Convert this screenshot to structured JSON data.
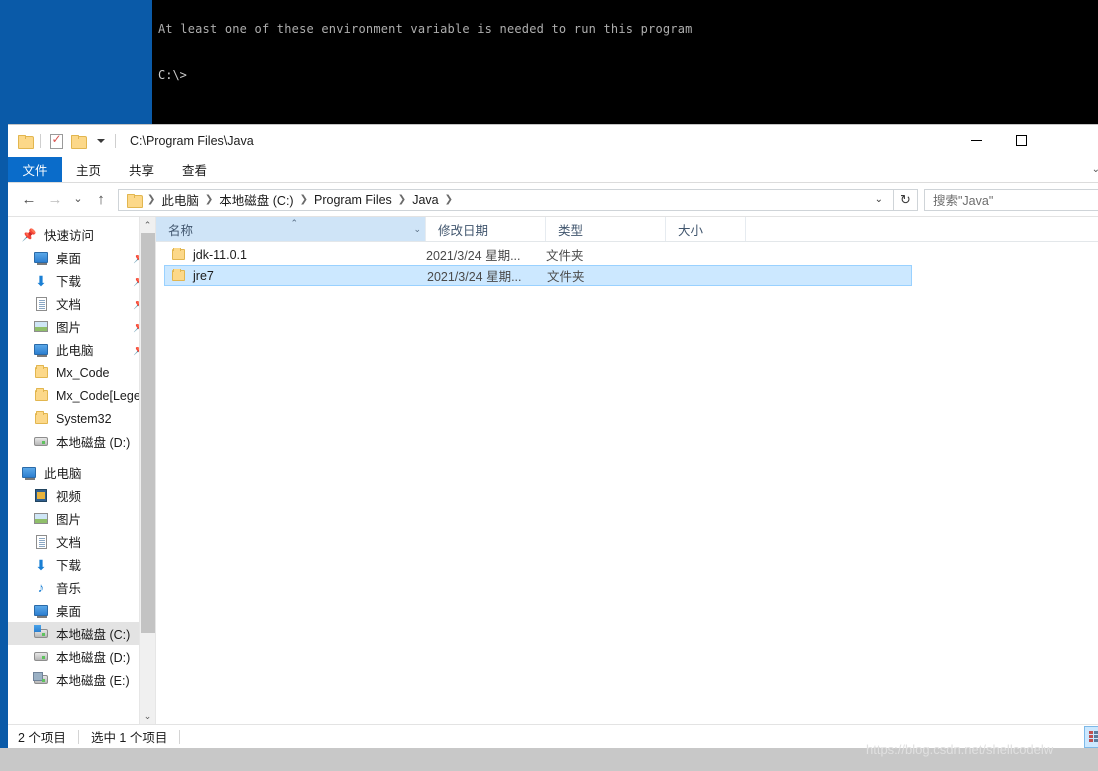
{
  "console": {
    "clipped_line": "At least one of these environment variable is needed to run this program",
    "prompt": "C:\\>"
  },
  "window": {
    "title": "C:\\Program Files\\Java",
    "quick_access": {
      "folder_icon": "folder-icon",
      "properties_icon": "properties-checklist-icon",
      "new_folder_icon": "new-folder-icon",
      "customize_icon": "chevron-down-icon"
    },
    "controls": {
      "minimize": "minimize-icon",
      "maximize": "maximize-icon"
    }
  },
  "ribbon": {
    "tabs": [
      {
        "label": "文件",
        "active": true
      },
      {
        "label": "主页",
        "active": false
      },
      {
        "label": "共享",
        "active": false
      },
      {
        "label": "查看",
        "active": false
      }
    ],
    "expand_caret": "⌄"
  },
  "navbar": {
    "back_icon": "back-arrow-icon",
    "forward_icon": "forward-arrow-icon",
    "recent_icon": "recent-locations-icon",
    "up_icon": "up-arrow-icon",
    "breadcrumbs": [
      "此电脑",
      "本地磁盘 (C:)",
      "Program Files",
      "Java"
    ],
    "dropdown_icon": "chevron-down-icon",
    "refresh_icon": "refresh-icon",
    "search_placeholder": "搜索\"Java\""
  },
  "navpane": {
    "items": [
      {
        "label": "快速访问",
        "icon": "star-pin-icon",
        "indent": 0,
        "pinned": false,
        "selected": false
      },
      {
        "label": "桌面",
        "icon": "desktop-icon",
        "indent": 1,
        "pinned": true,
        "selected": false
      },
      {
        "label": "下载",
        "icon": "downloads-icon",
        "indent": 1,
        "pinned": true,
        "selected": false
      },
      {
        "label": "文档",
        "icon": "documents-icon",
        "indent": 1,
        "pinned": true,
        "selected": false
      },
      {
        "label": "图片",
        "icon": "pictures-icon",
        "indent": 1,
        "pinned": true,
        "selected": false
      },
      {
        "label": "此电脑",
        "icon": "this-pc-icon",
        "indent": 1,
        "pinned": true,
        "selected": false
      },
      {
        "label": "Mx_Code",
        "icon": "folder-icon",
        "indent": 1,
        "pinned": false,
        "selected": false
      },
      {
        "label": "Mx_Code[Lege",
        "icon": "folder-icon",
        "indent": 1,
        "pinned": false,
        "selected": false
      },
      {
        "label": "System32",
        "icon": "folder-icon",
        "indent": 1,
        "pinned": false,
        "selected": false
      },
      {
        "label": "本地磁盘 (D:)",
        "icon": "drive-icon",
        "indent": 1,
        "pinned": false,
        "selected": false
      },
      {
        "label": "此电脑",
        "icon": "this-pc-icon",
        "indent": 0,
        "pinned": false,
        "selected": false
      },
      {
        "label": "视频",
        "icon": "videos-icon",
        "indent": 1,
        "pinned": false,
        "selected": false
      },
      {
        "label": "图片",
        "icon": "pictures-icon",
        "indent": 1,
        "pinned": false,
        "selected": false
      },
      {
        "label": "文档",
        "icon": "documents-icon",
        "indent": 1,
        "pinned": false,
        "selected": false
      },
      {
        "label": "下载",
        "icon": "downloads-icon",
        "indent": 1,
        "pinned": false,
        "selected": false
      },
      {
        "label": "音乐",
        "icon": "music-icon",
        "indent": 1,
        "pinned": false,
        "selected": false
      },
      {
        "label": "桌面",
        "icon": "desktop-icon",
        "indent": 1,
        "pinned": false,
        "selected": false
      },
      {
        "label": "本地磁盘 (C:)",
        "icon": "windows-drive-icon",
        "indent": 1,
        "pinned": false,
        "selected": true
      },
      {
        "label": "本地磁盘 (D:)",
        "icon": "drive-icon",
        "indent": 1,
        "pinned": false,
        "selected": false
      },
      {
        "label": "本地磁盘 (E:)",
        "icon": "network-drive-icon",
        "indent": 1,
        "pinned": false,
        "selected": false
      }
    ],
    "scroll_up_icon": "chevron-up-icon",
    "scroll_down_icon": "chevron-down-icon"
  },
  "filelist": {
    "columns": [
      {
        "key": "name",
        "label": "名称",
        "sorted": true
      },
      {
        "key": "date",
        "label": "修改日期",
        "sorted": false
      },
      {
        "key": "type",
        "label": "类型",
        "sorted": false
      },
      {
        "key": "size",
        "label": "大小",
        "sorted": false
      }
    ],
    "rows": [
      {
        "name": "jdk-11.0.1",
        "date": "2021/3/24 星期...",
        "type": "文件夹",
        "size": "",
        "icon": "folder-icon",
        "selected": false
      },
      {
        "name": "jre7",
        "date": "2021/3/24 星期...",
        "type": "文件夹",
        "size": "",
        "icon": "folder-icon",
        "selected": true
      }
    ]
  },
  "statusbar": {
    "item_count": "2 个项目",
    "selection": "选中 1 个项目",
    "view_details_icon": "details-view-icon",
    "view_icons_icon": "large-icons-view-icon"
  },
  "watermark": "https://blog.csdn.net/shellcodelw",
  "colors": {
    "accent": "#0a6cca",
    "desktop": "#0a5aa8",
    "selection": "#cce8ff",
    "header": "#cfe4f7"
  }
}
